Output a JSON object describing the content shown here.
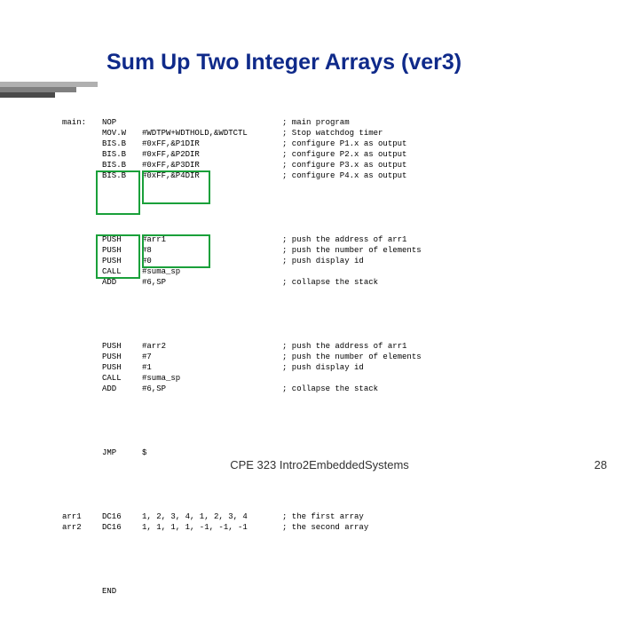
{
  "title": "Sum Up Two Integer Arrays (ver3)",
  "code": {
    "block1": [
      {
        "label": "main:",
        "mn": "NOP",
        "op": "",
        "cm": "; main program"
      },
      {
        "label": "",
        "mn": "MOV.W",
        "op": "#WDTPW+WDTHOLD,&WDTCTL",
        "cm": "; Stop watchdog timer"
      },
      {
        "label": "",
        "mn": "BIS.B",
        "op": "#0xFF,&P1DIR",
        "cm": "; configure P1.x as output"
      },
      {
        "label": "",
        "mn": "BIS.B",
        "op": "#0xFF,&P2DIR",
        "cm": "; configure P2.x as output"
      },
      {
        "label": "",
        "mn": "BIS.B",
        "op": "#0xFF,&P3DIR",
        "cm": "; configure P3.x as output"
      },
      {
        "label": "",
        "mn": "BIS.B",
        "op": "#0xFF,&P4DIR",
        "cm": "; configure P4.x as output"
      }
    ],
    "block2": [
      {
        "label": "",
        "mn": "PUSH",
        "op": "#arr1",
        "cm": "; push the address of arr1"
      },
      {
        "label": "",
        "mn": "PUSH",
        "op": "#8",
        "cm": "; push the number of elements"
      },
      {
        "label": "",
        "mn": "PUSH",
        "op": "#0",
        "cm": "; push display id"
      },
      {
        "label": "",
        "mn": "CALL",
        "op": "#suma_sp",
        "cm": ""
      },
      {
        "label": "",
        "mn": "ADD",
        "op": "#6,SP",
        "cm": "; collapse the stack"
      }
    ],
    "block3": [
      {
        "label": "",
        "mn": "PUSH",
        "op": "#arr2",
        "cm": "; push the address of arr1"
      },
      {
        "label": "",
        "mn": "PUSH",
        "op": "#7",
        "cm": "; push the number of elements"
      },
      {
        "label": "",
        "mn": "PUSH",
        "op": "#1",
        "cm": "; push display id"
      },
      {
        "label": "",
        "mn": "CALL",
        "op": "#suma_sp",
        "cm": ""
      },
      {
        "label": "",
        "mn": "ADD",
        "op": "#6,SP",
        "cm": "; collapse the stack"
      }
    ],
    "block4": [
      {
        "label": "",
        "mn": "JMP",
        "op": "$",
        "cm": ""
      }
    ],
    "block5": [
      {
        "label": "arr1",
        "mn": "DC16",
        "op": "1, 2, 3, 4, 1, 2, 3, 4",
        "cm": "; the first array"
      },
      {
        "label": "arr2",
        "mn": "DC16",
        "op": "1, 1, 1, 1, -1, -1, -1",
        "cm": "; the second array"
      }
    ],
    "block6": [
      {
        "label": "",
        "mn": "END",
        "op": "",
        "cm": ""
      }
    ]
  },
  "footer": {
    "center": "CPE 323 Intro2EmbeddedSystems",
    "page": "28"
  }
}
